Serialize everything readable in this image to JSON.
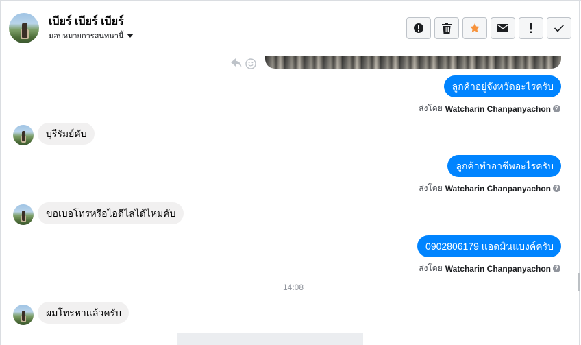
{
  "header": {
    "contact_name": "เบียร์ เบียร์ เบียร์",
    "assign_label": "มอบหมายการสนทนานี้",
    "toolbar_icons": [
      "alert-icon",
      "trash-icon",
      "star-icon",
      "mail-icon",
      "exclamation-icon",
      "check-icon"
    ],
    "star_color": "#f7923a"
  },
  "thread": {
    "messages": [
      {
        "type": "outgoing",
        "text": "ลูกค้าอยู่จังหวัดอะไรครับ",
        "sent_by_prefix": "ส่งโดย",
        "sent_by_name": "Watcharin Chanpanyachon"
      },
      {
        "type": "incoming",
        "text": "บุรีรัมย์คับ"
      },
      {
        "type": "outgoing",
        "text": "ลูกค้าทำอาชีพอะไรครับ",
        "sent_by_prefix": "ส่งโดย",
        "sent_by_name": "Watcharin Chanpanyachon"
      },
      {
        "type": "incoming",
        "text": "ขอเบอโทรหรือไอดีไลได้ไหมคับ"
      },
      {
        "type": "outgoing",
        "text": "0902806179 แอดมินแบงค์ครับ",
        "sent_by_prefix": "ส่งโดย",
        "sent_by_name": "Watcharin Chanpanyachon"
      },
      {
        "type": "time",
        "text": "14:08"
      },
      {
        "type": "incoming",
        "text": "ผมโทรหาแล้วครับ"
      }
    ],
    "help_glyph": "?"
  },
  "colors": {
    "outgoing_bubble": "#0084ff",
    "incoming_bubble": "#f1f0f0"
  }
}
